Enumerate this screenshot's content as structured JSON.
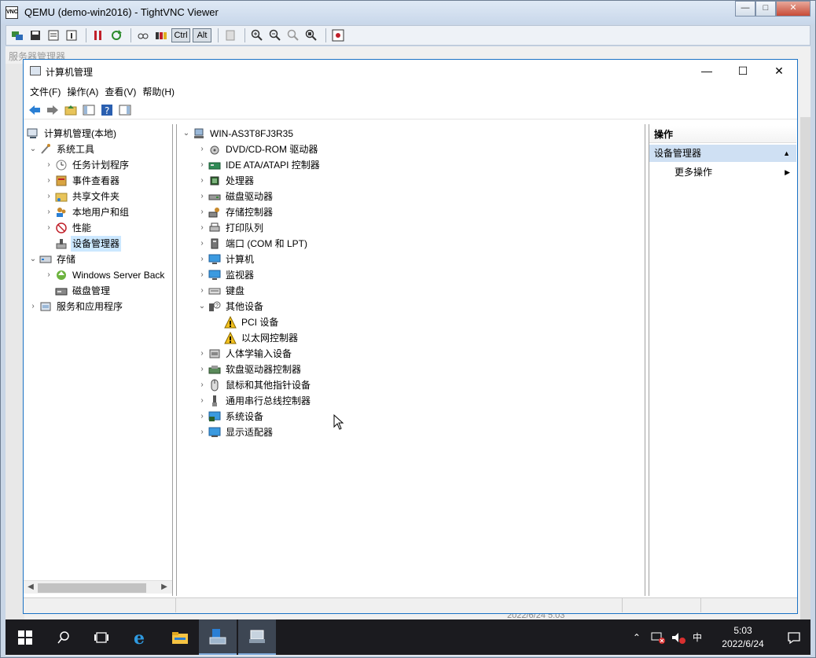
{
  "viewer": {
    "title": "QEMU (demo-win2016) - TightVNC Viewer",
    "icon_text": "VNC",
    "ctrl_label": "Ctrl",
    "alt_label": "Alt"
  },
  "background_window": {
    "title": "服务器管理器",
    "status_time": "2022/6/24 5:03"
  },
  "mmc": {
    "title": "计算机管理",
    "menu": [
      "文件(F)",
      "操作(A)",
      "查看(V)",
      "帮助(H)"
    ]
  },
  "left_tree": {
    "root": "计算机管理(本地)",
    "system_tools": "系统工具",
    "task_scheduler": "任务计划程序",
    "event_viewer": "事件查看器",
    "shared_folders": "共享文件夹",
    "local_users": "本地用户和组",
    "performance": "性能",
    "device_manager": "设备管理器",
    "storage": "存储",
    "windows_backup": "Windows Server Back",
    "disk_management": "磁盘管理",
    "services_apps": "服务和应用程序"
  },
  "device_tree": {
    "computer": "WIN-AS3T8FJ3R35",
    "items": [
      "DVD/CD-ROM 驱动器",
      "IDE ATA/ATAPI 控制器",
      "处理器",
      "磁盘驱动器",
      "存储控制器",
      "打印队列",
      "端口 (COM 和 LPT)",
      "计算机",
      "监视器",
      "键盘",
      "其他设备"
    ],
    "other_children": [
      "PCI 设备",
      "以太网控制器"
    ],
    "items_after": [
      "人体学输入设备",
      "软盘驱动器控制器",
      "鼠标和其他指针设备",
      "通用串行总线控制器",
      "系统设备",
      "显示适配器"
    ]
  },
  "actions": {
    "header": "操作",
    "group": "设备管理器",
    "more": "更多操作"
  },
  "taskbar": {
    "time": "5:03",
    "date": "2022/6/24",
    "ime": "中"
  },
  "colors": {
    "accent": "#1a72c5",
    "selection": "#cce8ff",
    "taskbar": "#1b1b1f"
  }
}
